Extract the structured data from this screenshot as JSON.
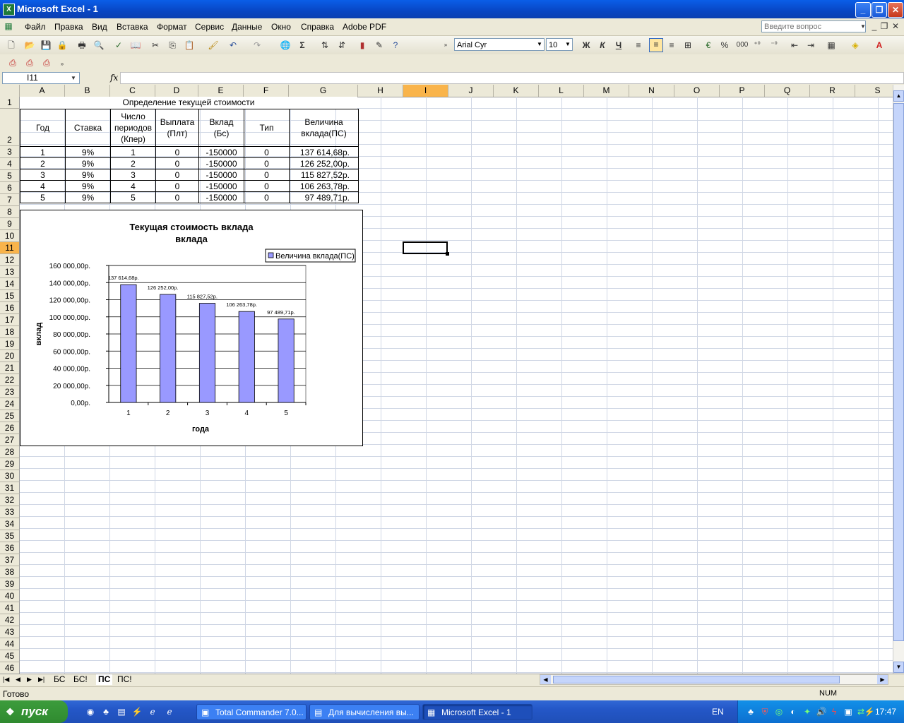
{
  "window": {
    "title": "Microsoft Excel - 1",
    "app_icon_label": "X"
  },
  "menu": [
    "Файл",
    "Правка",
    "Вид",
    "Вставка",
    "Формат",
    "Сервис",
    "Данные",
    "Окно",
    "Справка",
    "Adobe PDF"
  ],
  "help_box": {
    "placeholder": "Введите вопрос"
  },
  "format_toolbar": {
    "font": "Arial Cyr",
    "size": "10",
    "bold": "Ж",
    "italic": "К",
    "underline": "Ч",
    "percent": "%",
    "thousands": "000"
  },
  "formula_bar": {
    "name_box": "I11",
    "fx": "fx",
    "value": ""
  },
  "columns": [
    "A",
    "B",
    "C",
    "D",
    "E",
    "F",
    "G",
    "H",
    "I",
    "J",
    "K",
    "L",
    "M",
    "N",
    "O",
    "P",
    "Q",
    "R",
    "S"
  ],
  "active_cell": {
    "col": "I",
    "row": 11
  },
  "table": {
    "title": "Определение текущей стоимости",
    "headers": [
      "Год",
      "Ставка",
      "Число периодов (Кпер)",
      "Выплата (Плт)",
      "Вклад (Бс)",
      "Тип",
      "Величина вклада(ПС)"
    ],
    "rows": [
      [
        "1",
        "9%",
        "1",
        "0",
        "-150000",
        "0",
        "137 614,68р."
      ],
      [
        "2",
        "9%",
        "2",
        "0",
        "-150000",
        "0",
        "126 252,00р."
      ],
      [
        "3",
        "9%",
        "3",
        "0",
        "-150000",
        "0",
        "115 827,52р."
      ],
      [
        "4",
        "9%",
        "4",
        "0",
        "-150000",
        "0",
        "106 263,78р."
      ],
      [
        "5",
        "9%",
        "5",
        "0",
        "-150000",
        "0",
        "97 489,71р."
      ]
    ]
  },
  "chart_data": {
    "type": "bar",
    "title": "Текущая стоимость вклада вклада",
    "title_lines": [
      "Текущая стоимость вклада",
      "вклада"
    ],
    "xlabel": "года",
    "ylabel": "вклад",
    "categories": [
      "1",
      "2",
      "3",
      "4",
      "5"
    ],
    "series": [
      {
        "name": "Величина вклада(ПС)",
        "values": [
          137614.68,
          126252.0,
          115827.52,
          106263.78,
          97489.71
        ],
        "color": "#9999ff"
      }
    ],
    "data_labels": [
      "137 614,68р.",
      "126 252,00р.",
      "115 827,52р.",
      "106 263,78р.",
      "97 489,71р."
    ],
    "ylim": [
      0,
      160000
    ],
    "yticks": [
      0,
      20000,
      40000,
      60000,
      80000,
      100000,
      120000,
      140000,
      160000
    ],
    "ytick_labels": [
      "0,00р.",
      "20 000,00р.",
      "40 000,00р.",
      "60 000,00р.",
      "80 000,00р.",
      "100 000,00р.",
      "120 000,00р.",
      "140 000,00р.",
      "160 000,00р."
    ],
    "grid": true,
    "legend": "top-right"
  },
  "sheets": [
    {
      "name": "БС",
      "active": false
    },
    {
      "name": "БС!",
      "active": false
    },
    {
      "name": "ПС",
      "active": true
    },
    {
      "name": "ПС!",
      "active": false
    }
  ],
  "status": {
    "ready": "Готово",
    "num": "NUM"
  },
  "taskbar": {
    "start": "пуск",
    "tasks": [
      {
        "label": "Total Commander 7.0...",
        "active": false
      },
      {
        "label": "Для вычисления вы...",
        "active": false
      },
      {
        "label": "Microsoft Excel - 1",
        "active": true
      }
    ],
    "lang": "EN",
    "clock": "17:47"
  }
}
